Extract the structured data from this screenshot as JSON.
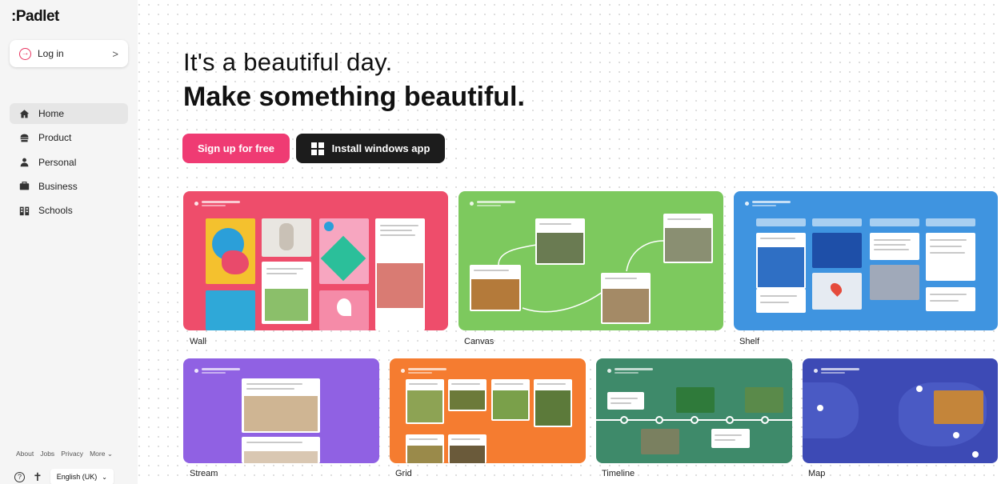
{
  "app": {
    "logo": ":Padlet"
  },
  "login": {
    "label": "Log in",
    "arrow": ">"
  },
  "nav": {
    "items": [
      {
        "label": "Home",
        "icon": "home-icon"
      },
      {
        "label": "Product",
        "icon": "product-icon"
      },
      {
        "label": "Personal",
        "icon": "person-icon"
      },
      {
        "label": "Business",
        "icon": "briefcase-icon"
      },
      {
        "label": "Schools",
        "icon": "school-icon"
      }
    ]
  },
  "footer": {
    "links": [
      "About",
      "Jobs",
      "Privacy",
      "More"
    ],
    "language": "English (UK)"
  },
  "hero": {
    "line1": "It's a beautiful day.",
    "line2": "Make something beautiful."
  },
  "actions": {
    "signup": "Sign up for free",
    "install": "Install windows app"
  },
  "templates": [
    {
      "label": "Wall",
      "color": "#ee4d6b"
    },
    {
      "label": "Canvas",
      "color": "#7dc95e"
    },
    {
      "label": "Shelf",
      "color": "#3f94e0"
    },
    {
      "label": "Stream",
      "color": "#9061e3"
    },
    {
      "label": "Grid",
      "color": "#f57c30"
    },
    {
      "label": "Timeline",
      "color": "#3e8a6a"
    },
    {
      "label": "Map",
      "color": "#3d4ab5"
    }
  ]
}
